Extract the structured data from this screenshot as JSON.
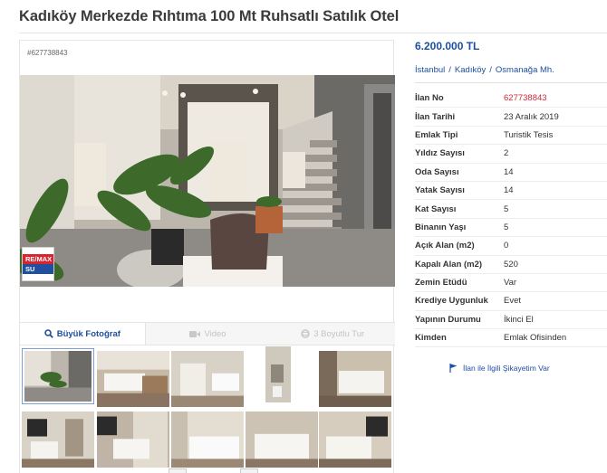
{
  "listing": {
    "title": "Kadıköy Merkezde Rıhtıma 100 Mt Ruhsatlı Satılık Otel",
    "number_small": "#627738843",
    "price": "6.200.000 TL"
  },
  "location": {
    "city": "İstanbul",
    "district": "Kadıköy",
    "neighborhood": "Osmanağa Mh.",
    "separator": "/"
  },
  "attributes": [
    {
      "label": "İlan No",
      "value": "627738843"
    },
    {
      "label": "İlan Tarihi",
      "value": "23 Aralık 2019"
    },
    {
      "label": "Emlak Tipi",
      "value": "Turistik Tesis"
    },
    {
      "label": "Yıldız Sayısı",
      "value": "2"
    },
    {
      "label": "Oda Sayısı",
      "value": "14"
    },
    {
      "label": "Yatak Sayısı",
      "value": "14"
    },
    {
      "label": "Kat Sayısı",
      "value": "5"
    },
    {
      "label": "Binanın Yaşı",
      "value": "5"
    },
    {
      "label": "Açık Alan (m2)",
      "value": "0"
    },
    {
      "label": "Kapalı Alan (m2)",
      "value": "520"
    },
    {
      "label": "Zemin Etüdü",
      "value": "Var"
    },
    {
      "label": "Krediye Uygunluk",
      "value": "Evet"
    },
    {
      "label": "Yapının Durumu",
      "value": "İkinci El"
    },
    {
      "label": "Kimden",
      "value": "Emlak Ofisinden"
    }
  ],
  "media_tabs": {
    "photo": "Büyük Fotoğraf",
    "video": "Video",
    "tour": "3 Boyutlu Tur"
  },
  "complaint_link": "İlan ile İlgili Şikayetim Var",
  "agency_logo": {
    "line1": "RE/MAX",
    "line2": "SU"
  },
  "colors": {
    "link_blue": "#1e4ea0",
    "listing_no_red": "#d0283a",
    "remax_red": "#d7242f",
    "remax_blue": "#1f4f9e"
  },
  "thumbnail_count": 10
}
